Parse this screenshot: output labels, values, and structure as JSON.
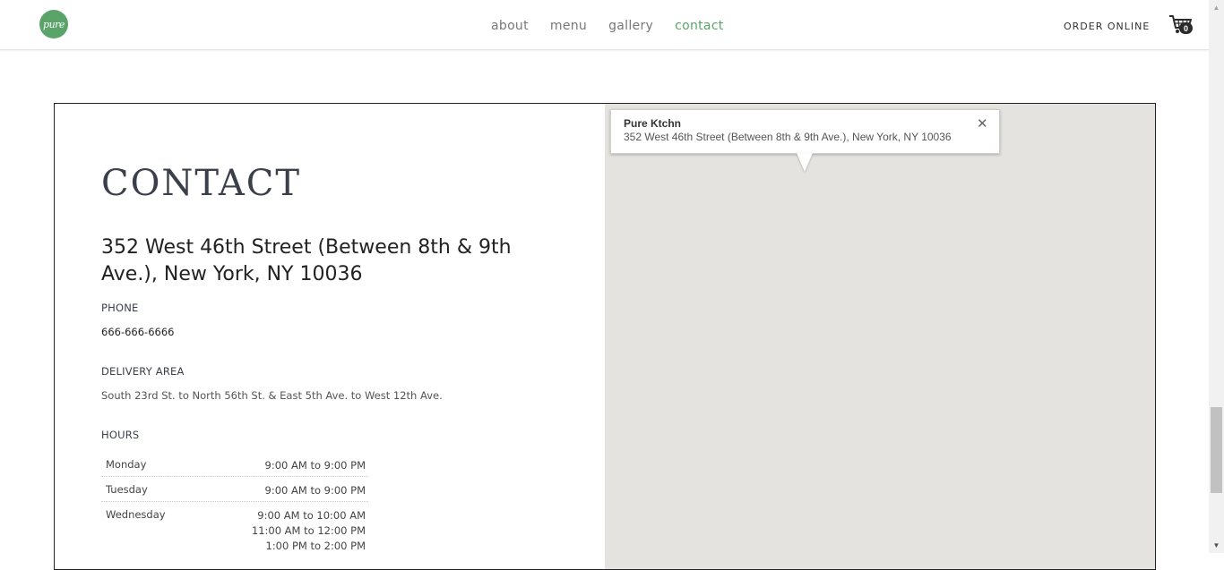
{
  "header": {
    "logo_text": "pure",
    "nav": [
      "about",
      "menu",
      "gallery",
      "contact"
    ],
    "nav_active": "contact",
    "order_online": "ORDER ONLINE",
    "cart_count": "0",
    "accent_color": "#5aa469"
  },
  "contact": {
    "title": "CONTACT",
    "address": "352 West 46th Street (Between 8th & 9th Ave.), New York, NY 10036",
    "phone_label": "PHONE",
    "phone": "666-666-6666",
    "delivery_label": "DELIVERY AREA",
    "delivery": "South 23rd St. to North 56th St. & East 5th Ave. to West 12th Ave.",
    "hours_label": "HOURS",
    "hours": [
      {
        "day": "Monday",
        "times": [
          "9:00 AM to 9:00 PM"
        ]
      },
      {
        "day": "Tuesday",
        "times": [
          "9:00 AM to 9:00 PM"
        ]
      },
      {
        "day": "Wednesday",
        "times": [
          "9:00 AM to 10:00 AM",
          "11:00 AM to 12:00 PM",
          "1:00 PM to 2:00 PM"
        ]
      }
    ]
  },
  "map": {
    "info_title": "Pure Ktchn",
    "info_address": "352 West 46th Street (Between 8th & 9th Ave.), New York, NY 10036",
    "close_glyph": "✕"
  }
}
